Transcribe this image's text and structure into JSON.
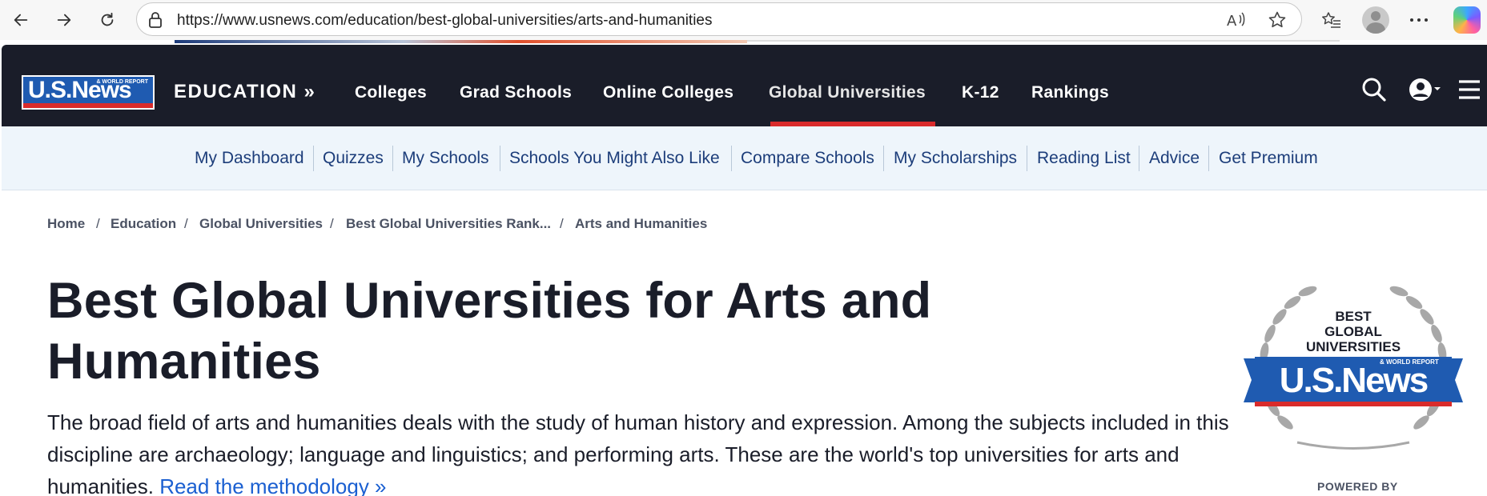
{
  "browser": {
    "url": "https://www.usnews.com/education/best-global-universities/arts-and-humanities",
    "icons": [
      "back-icon",
      "forward-icon",
      "refresh-icon",
      "lock-icon",
      "read-aloud-icon",
      "favorite-star-icon",
      "favorites-list-icon",
      "profile-avatar",
      "more-icon",
      "copilot-icon"
    ]
  },
  "header": {
    "logo_text": "U.S.News",
    "logo_sub": "& WORLD REPORT",
    "section": "EDUCATION »",
    "nav": [
      "Colleges",
      "Grad Schools",
      "Online Colleges",
      "Global Universities",
      "K-12",
      "Rankings"
    ],
    "active_nav": "Global Universities",
    "icons": [
      "search-icon",
      "account-icon",
      "menu-icon"
    ]
  },
  "subnav": {
    "items": [
      "My Dashboard",
      "Quizzes",
      "My Schools",
      "Schools You Might Also Like",
      "Compare Schools",
      "My Scholarships",
      "Reading List",
      "Advice",
      "Get Premium"
    ]
  },
  "breadcrumb": {
    "items": [
      "Home",
      "Education",
      "Global Universities",
      "Best Global Universities Rank...",
      "Arts and Humanities"
    ],
    "separator": "/"
  },
  "main": {
    "title_line1": "Best Global Universities for Arts and",
    "title_line2": "Humanities",
    "description": "The broad field of arts and humanities deals with the study of human history and expression. Among the subjects included in this discipline are archaeology; language and linguistics; and performing arts. These are the world's top universities for arts and humanities. ",
    "methodology_link": "Read the methodology »"
  },
  "badge": {
    "line1": "BEST",
    "line2": "GLOBAL",
    "line3": "UNIVERSITIES",
    "brand": "U.S.News",
    "brand_sub": "& WORLD REPORT",
    "powered_by": "POWERED BY"
  },
  "colors": {
    "nav_bg": "#1a1d29",
    "accent_red": "#d92b2b",
    "brand_blue": "#1f5bb1",
    "subnav_bg": "#eef5fb",
    "link_blue": "#1a5fd1"
  }
}
